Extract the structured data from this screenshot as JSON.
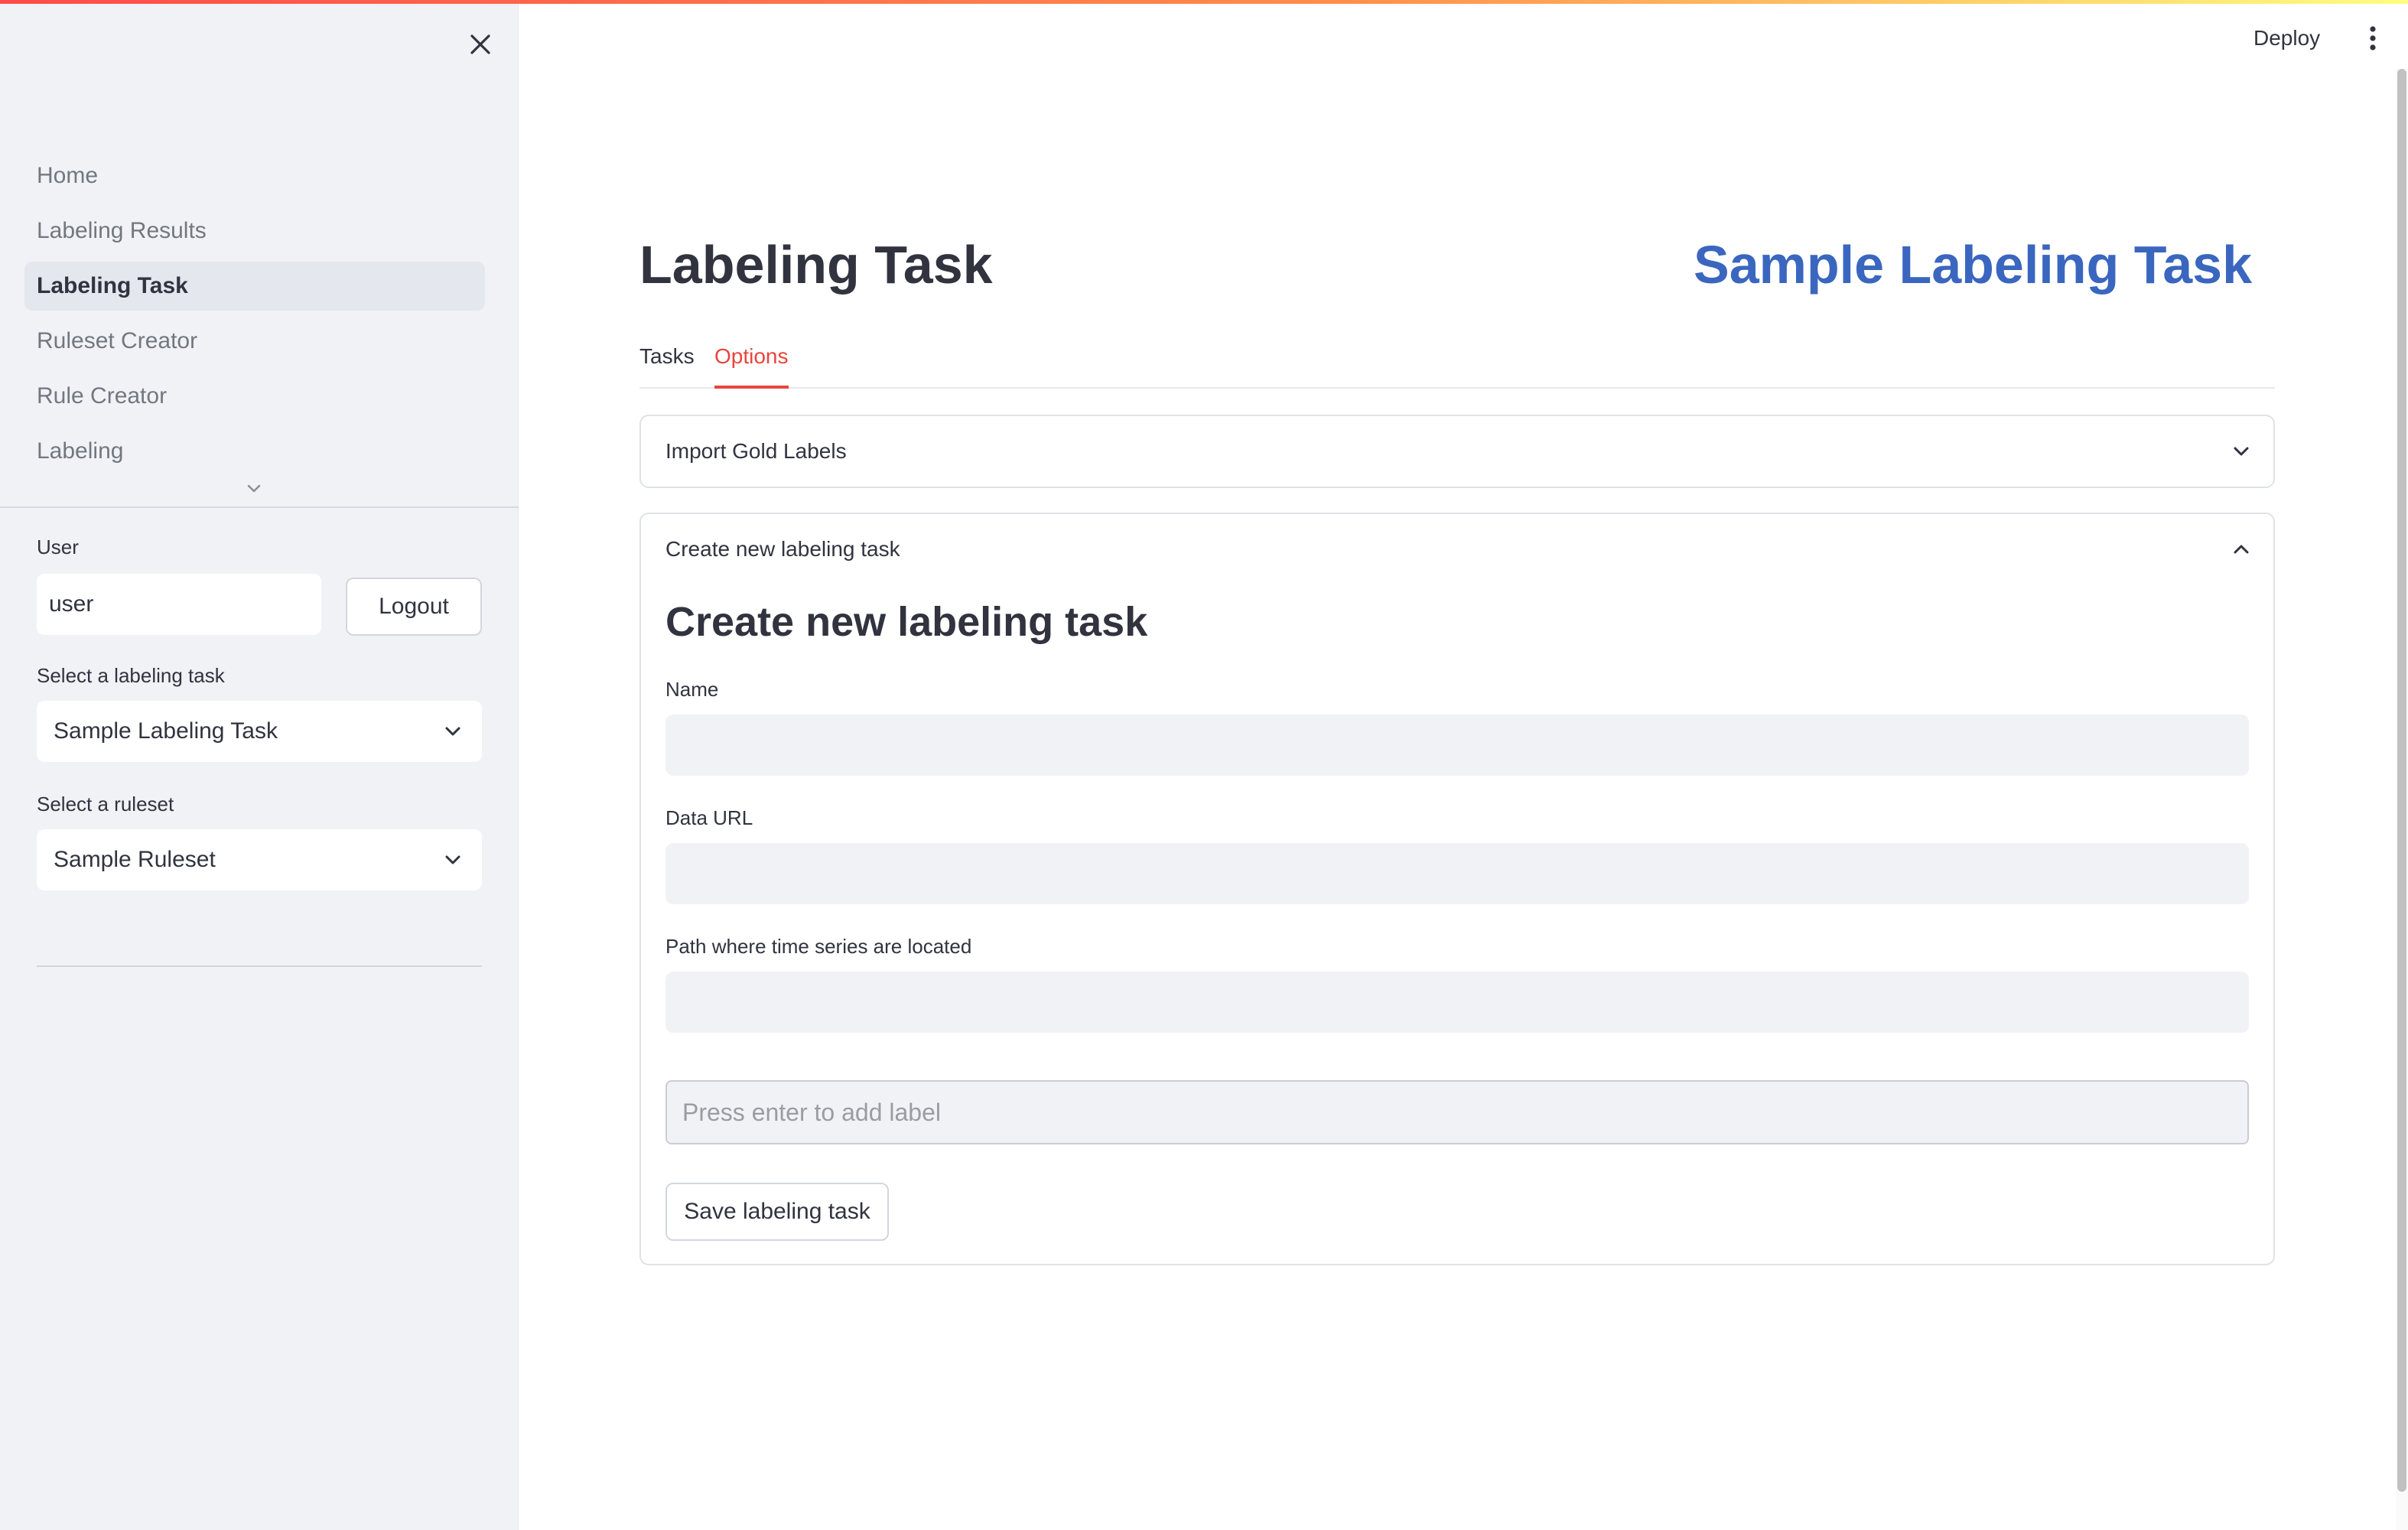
{
  "header": {
    "deploy_label": "Deploy"
  },
  "sidebar": {
    "nav_items": [
      {
        "label": "Home",
        "active": false
      },
      {
        "label": "Labeling Results",
        "active": false
      },
      {
        "label": "Labeling Task",
        "active": true
      },
      {
        "label": "Ruleset Creator",
        "active": false
      },
      {
        "label": "Rule Creator",
        "active": false
      },
      {
        "label": "Labeling",
        "active": false
      }
    ],
    "user_label": "User",
    "user_value": "user",
    "logout_label": "Logout",
    "task_select_label": "Select a labeling task",
    "task_select_value": "Sample Labeling Task",
    "ruleset_select_label": "Select a ruleset",
    "ruleset_select_value": "Sample Ruleset"
  },
  "main": {
    "page_title": "Labeling Task",
    "current_task_title": "Sample Labeling Task",
    "tabs": [
      {
        "label": "Tasks",
        "active": false
      },
      {
        "label": "Options",
        "active": true
      }
    ],
    "import_expander": {
      "label": "Import Gold Labels",
      "expanded": false
    },
    "create_expander": {
      "label": "Create new labeling task",
      "expanded": true,
      "heading": "Create new labeling task",
      "fields": [
        {
          "label": "Name",
          "value": ""
        },
        {
          "label": "Data URL",
          "value": ""
        },
        {
          "label": "Path where time series are located",
          "value": ""
        }
      ],
      "label_input_placeholder": "Press enter to add label",
      "save_label": "Save labeling task"
    }
  },
  "colors": {
    "accent": "#e8453c",
    "task_title": "#3a66bf",
    "sidebar_bg": "#f0f2f6",
    "text": "#31333f"
  }
}
